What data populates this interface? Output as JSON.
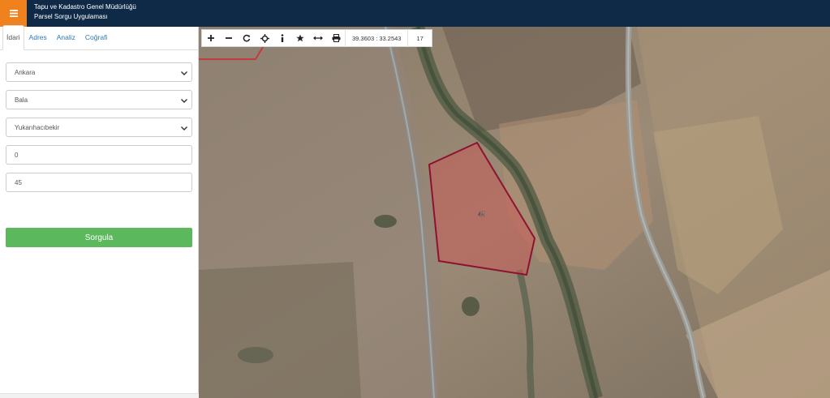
{
  "header": {
    "title_line1": "Tapu ve Kadastro Genel Müdürlüğü",
    "title_line2": "Parsel Sorgu Uygulaması",
    "menu_icon": "hamburger-icon",
    "colors": {
      "bar": "#0e2a47",
      "menu": "#f0821e"
    }
  },
  "sidebar": {
    "tabs": [
      {
        "label": "İdari",
        "active": true
      },
      {
        "label": "Adres",
        "active": false
      },
      {
        "label": "Analiz",
        "active": false
      },
      {
        "label": "Coğrafi",
        "active": false
      }
    ],
    "form": {
      "province": "Ankara",
      "district": "Bala",
      "neighborhood": "Yukarıhacıbekir",
      "block": "0",
      "parcel": "45",
      "submit_label": "Sorgula"
    },
    "submit_color": "#5cb85c"
  },
  "map": {
    "toolbar": {
      "tools": [
        "zoom-in-icon",
        "zoom-out-icon",
        "refresh-icon",
        "locate-icon",
        "info-icon",
        "favorite-star-icon",
        "measure-icon",
        "print-icon"
      ],
      "coordinates": "39.3603 : 33.2543",
      "zoom_level": "17"
    },
    "parcel_label": "45",
    "parcel_color": "#b01a3a"
  }
}
